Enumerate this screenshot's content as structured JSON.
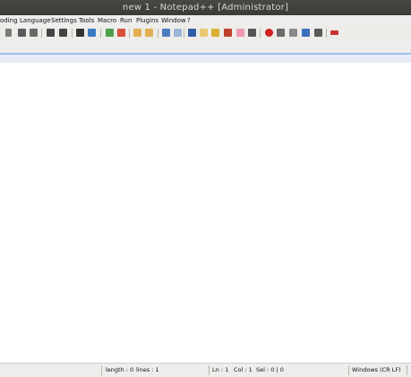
{
  "window": {
    "title": "new 1 - Notepad++ [Administrator]"
  },
  "menu": {
    "items": [
      "oding",
      "Language",
      "Settings",
      "Tools",
      "Macro",
      "Run",
      "Plugins",
      "Window",
      "?"
    ]
  },
  "toolbar": {
    "icons": [
      "cut-icon",
      "copy-icon",
      "paste-icon",
      "undo-icon",
      "redo-icon",
      "find-icon",
      "replace-icon",
      "zoom-in-icon",
      "zoom-out-icon",
      "sync-v-icon",
      "sync-h-icon",
      "word-wrap-icon",
      "show-all-chars-icon",
      "indent-guide-icon",
      "doc-map-icon",
      "function-list-icon",
      "folder-workspace-icon",
      "monitoring-icon",
      "record-macro-icon",
      "stop-record-icon",
      "play-macro-icon",
      "run-macro-multiple-icon",
      "save-macro-icon",
      "spell-check-icon"
    ]
  },
  "status": {
    "length": "length : 0",
    "lines": "lines : 1",
    "ln": "Ln : 1",
    "col": "Col : 1",
    "sel": "Sel : 0 | 0",
    "eol": "Windows (CR LF)"
  }
}
